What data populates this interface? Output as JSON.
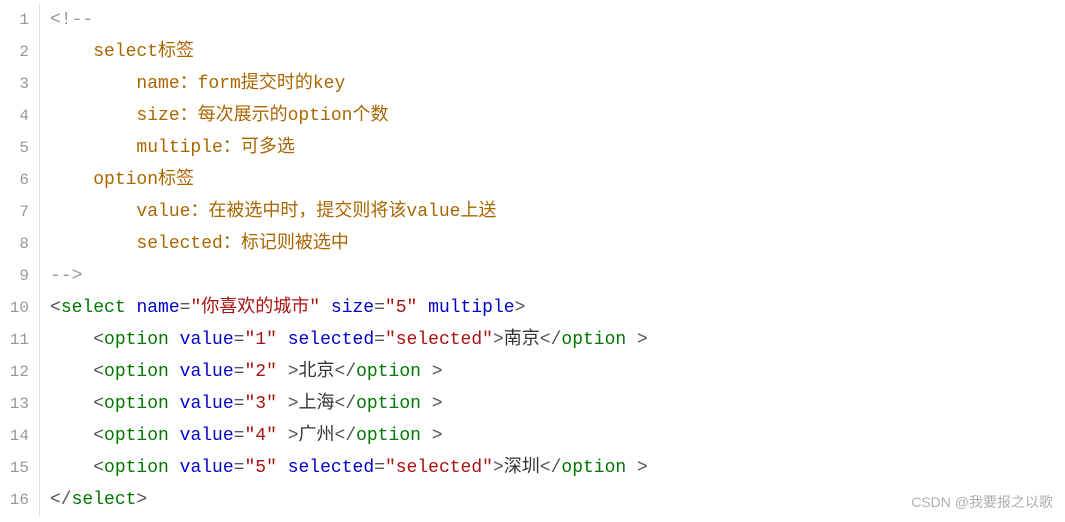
{
  "lines": [
    {
      "n": 1,
      "tokens": [
        {
          "c": "c-comment",
          "t": "<!--"
        }
      ]
    },
    {
      "n": 2,
      "tokens": [
        {
          "c": "c-comment",
          "t": "    "
        },
        {
          "c": "comment-body",
          "t": "select标签"
        }
      ]
    },
    {
      "n": 3,
      "tokens": [
        {
          "c": "c-comment",
          "t": "        "
        },
        {
          "c": "comment-body",
          "t": "name：form提交时的key"
        }
      ]
    },
    {
      "n": 4,
      "tokens": [
        {
          "c": "c-comment",
          "t": "        "
        },
        {
          "c": "comment-body",
          "t": "size：每次展示的option个数"
        }
      ]
    },
    {
      "n": 5,
      "tokens": [
        {
          "c": "c-comment",
          "t": "        "
        },
        {
          "c": "comment-body",
          "t": "multiple：可多选"
        }
      ]
    },
    {
      "n": 6,
      "tokens": [
        {
          "c": "c-comment",
          "t": "    "
        },
        {
          "c": "comment-body",
          "t": "option标签"
        }
      ]
    },
    {
      "n": 7,
      "tokens": [
        {
          "c": "c-comment",
          "t": "        "
        },
        {
          "c": "comment-body",
          "t": "value：在被选中时，提交则将该value上送"
        }
      ]
    },
    {
      "n": 8,
      "tokens": [
        {
          "c": "c-comment",
          "t": "        "
        },
        {
          "c": "comment-body",
          "t": "selected：标记则被选中"
        }
      ]
    },
    {
      "n": 9,
      "tokens": [
        {
          "c": "c-comment",
          "t": "-->"
        }
      ]
    },
    {
      "n": 10,
      "tokens": [
        {
          "c": "c-punct",
          "t": "<"
        },
        {
          "c": "c-tag",
          "t": "select"
        },
        {
          "c": "",
          "t": " "
        },
        {
          "c": "c-attr",
          "t": "name"
        },
        {
          "c": "c-punct",
          "t": "="
        },
        {
          "c": "c-string",
          "t": "\"你喜欢的城市\""
        },
        {
          "c": "",
          "t": " "
        },
        {
          "c": "c-attr",
          "t": "size"
        },
        {
          "c": "c-punct",
          "t": "="
        },
        {
          "c": "c-string",
          "t": "\"5\""
        },
        {
          "c": "",
          "t": " "
        },
        {
          "c": "c-attr",
          "t": "multiple"
        },
        {
          "c": "c-punct",
          "t": ">"
        }
      ]
    },
    {
      "n": 11,
      "tokens": [
        {
          "c": "",
          "t": "    "
        },
        {
          "c": "c-punct",
          "t": "<"
        },
        {
          "c": "c-tag",
          "t": "option"
        },
        {
          "c": "",
          "t": " "
        },
        {
          "c": "c-attr",
          "t": "value"
        },
        {
          "c": "c-punct",
          "t": "="
        },
        {
          "c": "c-string",
          "t": "\"1\""
        },
        {
          "c": "",
          "t": " "
        },
        {
          "c": "c-attr",
          "t": "selected"
        },
        {
          "c": "c-punct",
          "t": "="
        },
        {
          "c": "c-string",
          "t": "\"selected\""
        },
        {
          "c": "c-punct",
          "t": ">"
        },
        {
          "c": "c-text",
          "t": "南京"
        },
        {
          "c": "c-punct",
          "t": "</"
        },
        {
          "c": "c-tag",
          "t": "option "
        },
        {
          "c": "c-punct",
          "t": ">"
        }
      ]
    },
    {
      "n": 12,
      "tokens": [
        {
          "c": "",
          "t": "    "
        },
        {
          "c": "c-punct",
          "t": "<"
        },
        {
          "c": "c-tag",
          "t": "option"
        },
        {
          "c": "",
          "t": " "
        },
        {
          "c": "c-attr",
          "t": "value"
        },
        {
          "c": "c-punct",
          "t": "="
        },
        {
          "c": "c-string",
          "t": "\"2\""
        },
        {
          "c": "",
          "t": " "
        },
        {
          "c": "c-punct",
          "t": ">"
        },
        {
          "c": "c-text",
          "t": "北京"
        },
        {
          "c": "c-punct",
          "t": "</"
        },
        {
          "c": "c-tag",
          "t": "option "
        },
        {
          "c": "c-punct",
          "t": ">"
        }
      ]
    },
    {
      "n": 13,
      "tokens": [
        {
          "c": "",
          "t": "    "
        },
        {
          "c": "c-punct",
          "t": "<"
        },
        {
          "c": "c-tag",
          "t": "option"
        },
        {
          "c": "",
          "t": " "
        },
        {
          "c": "c-attr",
          "t": "value"
        },
        {
          "c": "c-punct",
          "t": "="
        },
        {
          "c": "c-string",
          "t": "\"3\""
        },
        {
          "c": "",
          "t": " "
        },
        {
          "c": "c-punct",
          "t": ">"
        },
        {
          "c": "c-text",
          "t": "上海"
        },
        {
          "c": "c-punct",
          "t": "</"
        },
        {
          "c": "c-tag",
          "t": "option "
        },
        {
          "c": "c-punct",
          "t": ">"
        }
      ]
    },
    {
      "n": 14,
      "tokens": [
        {
          "c": "",
          "t": "    "
        },
        {
          "c": "c-punct",
          "t": "<"
        },
        {
          "c": "c-tag",
          "t": "option"
        },
        {
          "c": "",
          "t": " "
        },
        {
          "c": "c-attr",
          "t": "value"
        },
        {
          "c": "c-punct",
          "t": "="
        },
        {
          "c": "c-string",
          "t": "\"4\""
        },
        {
          "c": "",
          "t": " "
        },
        {
          "c": "c-punct",
          "t": ">"
        },
        {
          "c": "c-text",
          "t": "广州"
        },
        {
          "c": "c-punct",
          "t": "</"
        },
        {
          "c": "c-tag",
          "t": "option "
        },
        {
          "c": "c-punct",
          "t": ">"
        }
      ]
    },
    {
      "n": 15,
      "tokens": [
        {
          "c": "",
          "t": "    "
        },
        {
          "c": "c-punct",
          "t": "<"
        },
        {
          "c": "c-tag",
          "t": "option"
        },
        {
          "c": "",
          "t": " "
        },
        {
          "c": "c-attr",
          "t": "value"
        },
        {
          "c": "c-punct",
          "t": "="
        },
        {
          "c": "c-string",
          "t": "\"5\""
        },
        {
          "c": "",
          "t": " "
        },
        {
          "c": "c-attr",
          "t": "selected"
        },
        {
          "c": "c-punct",
          "t": "="
        },
        {
          "c": "c-string",
          "t": "\"selected\""
        },
        {
          "c": "c-punct",
          "t": ">"
        },
        {
          "c": "c-text",
          "t": "深圳"
        },
        {
          "c": "c-punct",
          "t": "</"
        },
        {
          "c": "c-tag",
          "t": "option "
        },
        {
          "c": "c-punct",
          "t": ">"
        }
      ]
    },
    {
      "n": 16,
      "tokens": [
        {
          "c": "c-punct",
          "t": "</"
        },
        {
          "c": "c-tag",
          "t": "select"
        },
        {
          "c": "c-punct",
          "t": ">"
        }
      ]
    }
  ],
  "watermark": "CSDN @我要报之以歌"
}
